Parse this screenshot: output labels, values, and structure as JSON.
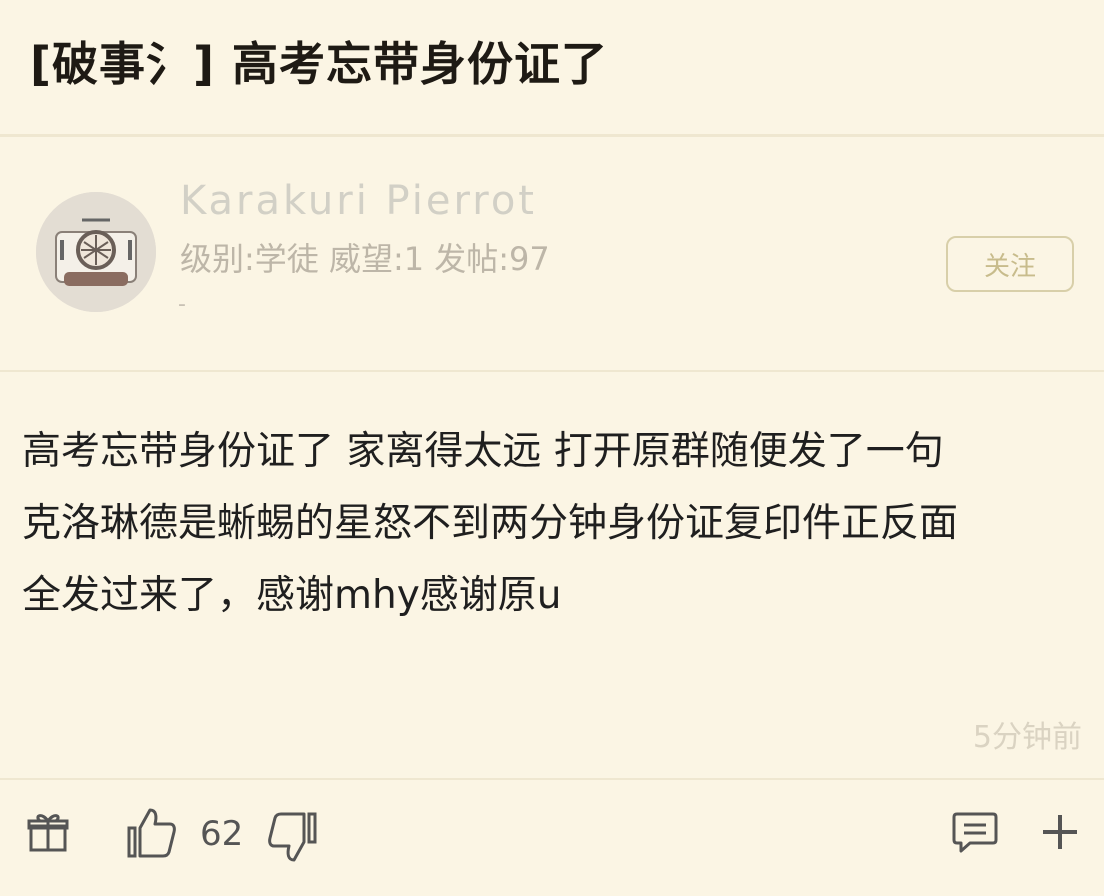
{
  "post": {
    "title": "[破事氵] 高考忘带身份证了",
    "body_lines": [
      "高考忘带身份证了 家离得太远 打开原群随便发了一句",
      "克洛琳德是蜥蜴的星怒不到两分钟身份证复印件正反面",
      "全发过来了，感谢mhy感谢原u"
    ],
    "timestamp": "5分钟前"
  },
  "author": {
    "name": "Karakuri Pierrot",
    "stats": "级别:学徒 威望:1 发帖:97",
    "signature": "-",
    "follow_label": "关注"
  },
  "actions": {
    "like_count": "62",
    "icons": [
      "gift-icon",
      "thumbs-up-icon",
      "thumbs-down-icon",
      "comment-icon",
      "plus-icon"
    ]
  },
  "colors": {
    "background": "#fbf5e4",
    "divider": "#efe7d0",
    "muted_text": "#bdb6a8",
    "follow_border": "#d8cfa9"
  }
}
